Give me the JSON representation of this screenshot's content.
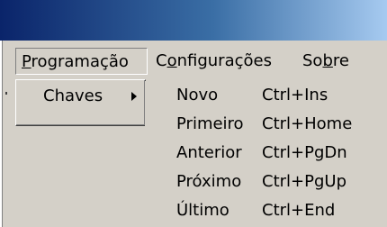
{
  "menubar": {
    "items": [
      {
        "label": "Programação",
        "mnemonic_index": 0
      },
      {
        "label": "Configurações",
        "mnemonic_index": 1
      },
      {
        "label": "Sobre",
        "mnemonic_index": 2
      }
    ]
  },
  "dropdown": {
    "items": [
      {
        "label": "Chaves",
        "has_submenu": true
      }
    ]
  },
  "submenu": {
    "items": [
      {
        "label": "Novo",
        "shortcut": "Ctrl+Ins"
      },
      {
        "label": "Primeiro",
        "shortcut": "Ctrl+Home"
      },
      {
        "label": "Anterior",
        "shortcut": "Ctrl+PgDn"
      },
      {
        "label": "Próximo",
        "shortcut": "Ctrl+PgUp"
      },
      {
        "label": "Último",
        "shortcut": "Ctrl+End"
      }
    ]
  },
  "colors": {
    "titlebar_start": "#0a246a",
    "titlebar_end": "#a6caf0",
    "face": "#d4d0c8"
  }
}
